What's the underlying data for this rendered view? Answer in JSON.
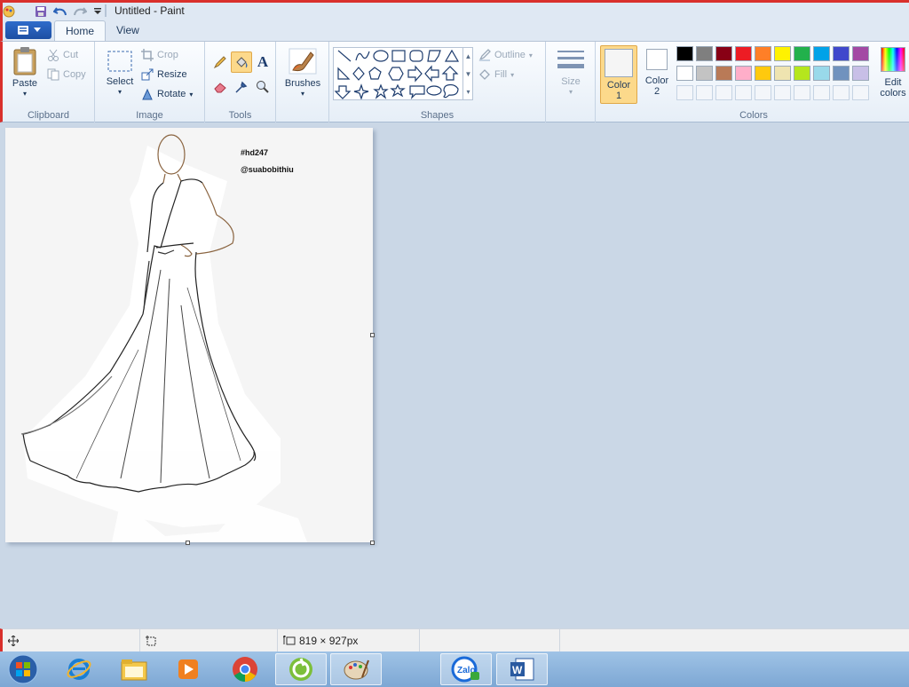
{
  "window": {
    "title": "Untitled - Paint"
  },
  "tabs": {
    "home": "Home",
    "view": "View"
  },
  "clipboard": {
    "paste": "Paste",
    "cut": "Cut",
    "copy": "Copy",
    "label": "Clipboard"
  },
  "image": {
    "select": "Select",
    "crop": "Crop",
    "resize": "Resize",
    "rotate": "Rotate",
    "label": "Image"
  },
  "tools": {
    "label": "Tools"
  },
  "brushes": {
    "label": "Brushes"
  },
  "shapes": {
    "outline": "Outline",
    "fill": "Fill",
    "label": "Shapes"
  },
  "size": {
    "label": "Size"
  },
  "colors_group": {
    "color1_line1": "Color",
    "color1_line2": "1",
    "color2_line1": "Color",
    "color2_line2": "2",
    "edit_line1": "Edit",
    "edit_line2": "colors",
    "label": "Colors",
    "palette_row1": [
      "#000000",
      "#7f7f7f",
      "#880015",
      "#ed1c24",
      "#ff7f27",
      "#fff200",
      "#22b14c",
      "#00a2e8",
      "#3f48cc",
      "#a349a4"
    ],
    "palette_row2": [
      "#ffffff",
      "#c3c3c3",
      "#b97a57",
      "#ffaec9",
      "#ffc90e",
      "#efe4b0",
      "#b5e61d",
      "#99d9ea",
      "#7092be",
      "#c8bfe7"
    ]
  },
  "canvas": {
    "tag1": "#hd247",
    "tag2": "@suabobithiu"
  },
  "status": {
    "size": "819 × 927px"
  },
  "colors": {
    "accent": "#d9302c",
    "ribbon_bg": "#f5f9fd",
    "workspace": "#cad7e6",
    "selected": "#fcd98b"
  }
}
